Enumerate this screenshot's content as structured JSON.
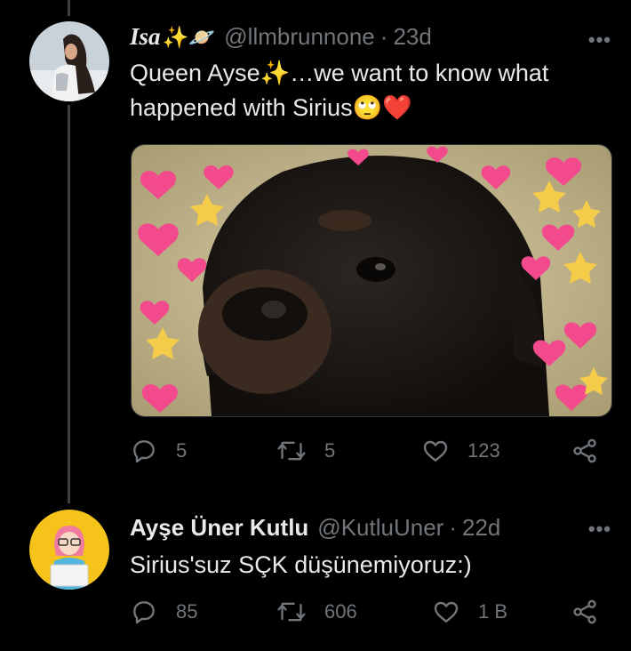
{
  "tweet1": {
    "name": "Isa",
    "name_emojis": "✨🪐",
    "handle": "@llmbrunnone",
    "separator": "·",
    "time": "23d",
    "more": "•••",
    "line1": "Queen Ayse✨…we want to know what",
    "line2": "happened with Sirius🙄❤️",
    "replies": "5",
    "retweets": "5",
    "likes": "123"
  },
  "tweet2": {
    "name": "Ayşe Üner Kutlu",
    "handle": "@KutluUner",
    "separator": "·",
    "time": "22d",
    "more": "•••",
    "line1": "Sirius'suz SÇK düşünemiyoruz:)",
    "replies": "85",
    "retweets": "606",
    "likes": "1 B"
  },
  "icons": [
    "reply-icon",
    "retweet-icon",
    "like-icon",
    "share-icon",
    "more-icon"
  ],
  "colors": {
    "background": "#000000",
    "text": "#e7e9ea",
    "secondary": "#71767b",
    "thread_line": "#3d4247"
  }
}
